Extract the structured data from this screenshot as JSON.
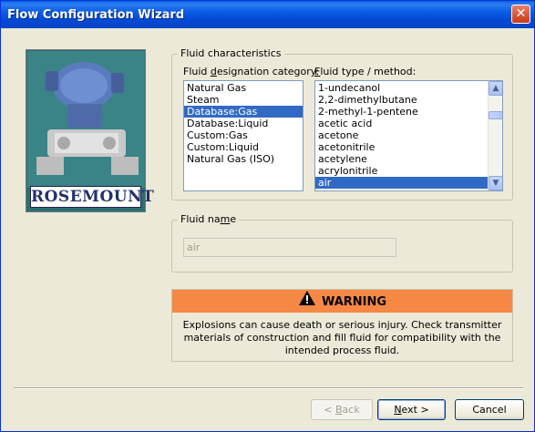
{
  "window": {
    "title": "Flow Configuration Wizard"
  },
  "logo": {
    "brand": "ROSEMOUNT"
  },
  "fluid_characteristics": {
    "legend": "Fluid characteristics",
    "category_label_pre": "Fluid ",
    "category_label_ul": "d",
    "category_label_post": "esignation category:",
    "categories": [
      "Natural Gas",
      "Steam",
      "Database:Gas",
      "Database:Liquid",
      "Custom:Gas",
      "Custom:Liquid",
      "Natural Gas (ISO)"
    ],
    "selected_category": "Database:Gas",
    "type_label_pre": "",
    "type_label_ul": "F",
    "type_label_post": "luid type / method:",
    "types": [
      "1-undecanol",
      "2,2-dimethylbutane",
      "2-methyl-1-pentene",
      "acetic acid",
      "acetone",
      "acetonitrile",
      "acetylene",
      "acrylonitrile",
      "air"
    ],
    "selected_type": "air"
  },
  "fluid_name": {
    "legend_pre": "Fluid na",
    "legend_ul": "m",
    "legend_post": "e",
    "value": "air"
  },
  "warning": {
    "title": "WARNING",
    "message": "Explosions can cause death or serious injury. Check transmitter materials of construction and fill fluid for compatibility with the intended process fluid.",
    "color": "#f58845"
  },
  "buttons": {
    "back": {
      "pre": "< ",
      "ul": "B",
      "post": "ack",
      "enabled": false
    },
    "next": {
      "pre": "",
      "ul": "N",
      "post": "ext >",
      "enabled": true
    },
    "cancel": {
      "label": "Cancel",
      "enabled": true
    }
  },
  "colors": {
    "title_bar": "#0b5ce6",
    "selection": "#316ac5",
    "dialog_bg": "#ece9d8"
  }
}
